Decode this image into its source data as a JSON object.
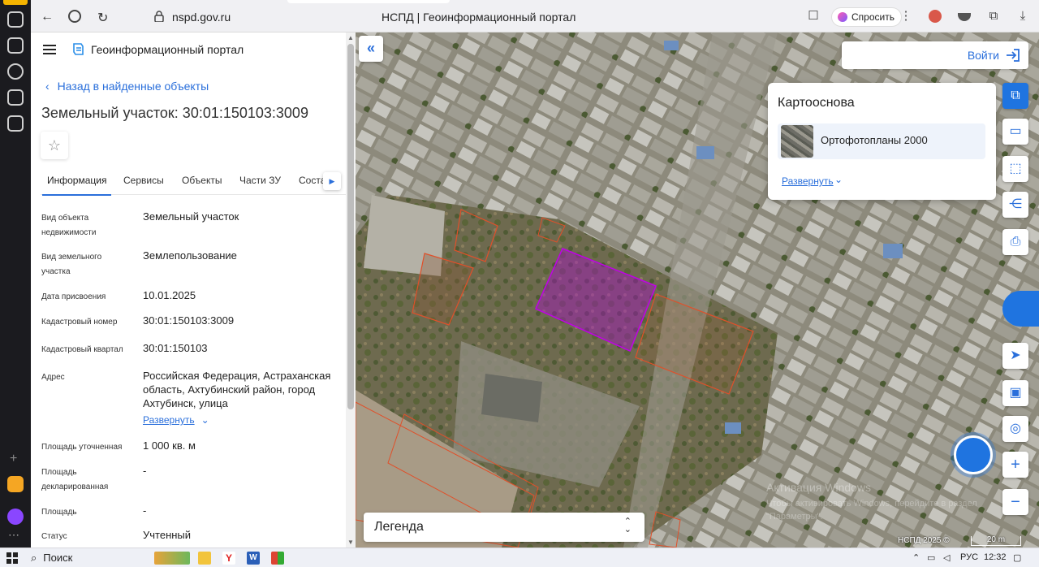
{
  "browser": {
    "url": "nspd.gov.ru",
    "page_title": "НСПД | Геоинформационный портал",
    "ask_button": "Спросить"
  },
  "panel": {
    "portal_name": "Геоинформационный портал",
    "back_link": "Назад в найденные объекты",
    "heading": "Земельный участок: 30:01:150103:3009",
    "tabs": [
      "Информация",
      "Сервисы",
      "Объекты",
      "Части ЗУ",
      "Соста"
    ],
    "active_tab": "Информация",
    "rows": [
      {
        "key": "Вид объекта недвижимости",
        "value": "Земельный участок"
      },
      {
        "key": "Вид земельного участка",
        "value": "Землепользование"
      },
      {
        "key": "Дата присвоения",
        "value": "10.01.2025"
      },
      {
        "key": "Кадастровый номер",
        "value": "30:01:150103:3009"
      },
      {
        "key": "Кадастровый квартал",
        "value": "30:01:150103"
      },
      {
        "key": "Адрес",
        "value": "Российская Федерация, Астраханская область, Ахтубинский район, город Ахтубинск, улица"
      },
      {
        "key": "Площадь уточненная",
        "value": "1 000 кв. м"
      },
      {
        "key": "Площадь декларированная",
        "value": "-"
      },
      {
        "key": "Площадь",
        "value": "-"
      },
      {
        "key": "Статус",
        "value": "Учтенный"
      }
    ],
    "expand_label": "Развернуть"
  },
  "map": {
    "login": "Войти",
    "basemap_title": "Картооснова",
    "basemap_selected": "Ортофотопланы 2000",
    "basemap_expand": "Развернуть",
    "legend": "Легенда",
    "copyright": "НСПД 2025 ©",
    "scale": "20 m",
    "watermark_1": "Активация Windows",
    "watermark_2": "Чтобы активировать Windows, перейдите в раздел",
    "watermark_3": "\"Параметры\"."
  },
  "taskbar": {
    "search": "Поиск",
    "lang": "РУС",
    "time": "12:32"
  },
  "colors": {
    "accent": "#1f74e0",
    "link": "#2a6fdb",
    "parcel_selected": "#b000d8",
    "parcel_border": "#e0502a"
  }
}
